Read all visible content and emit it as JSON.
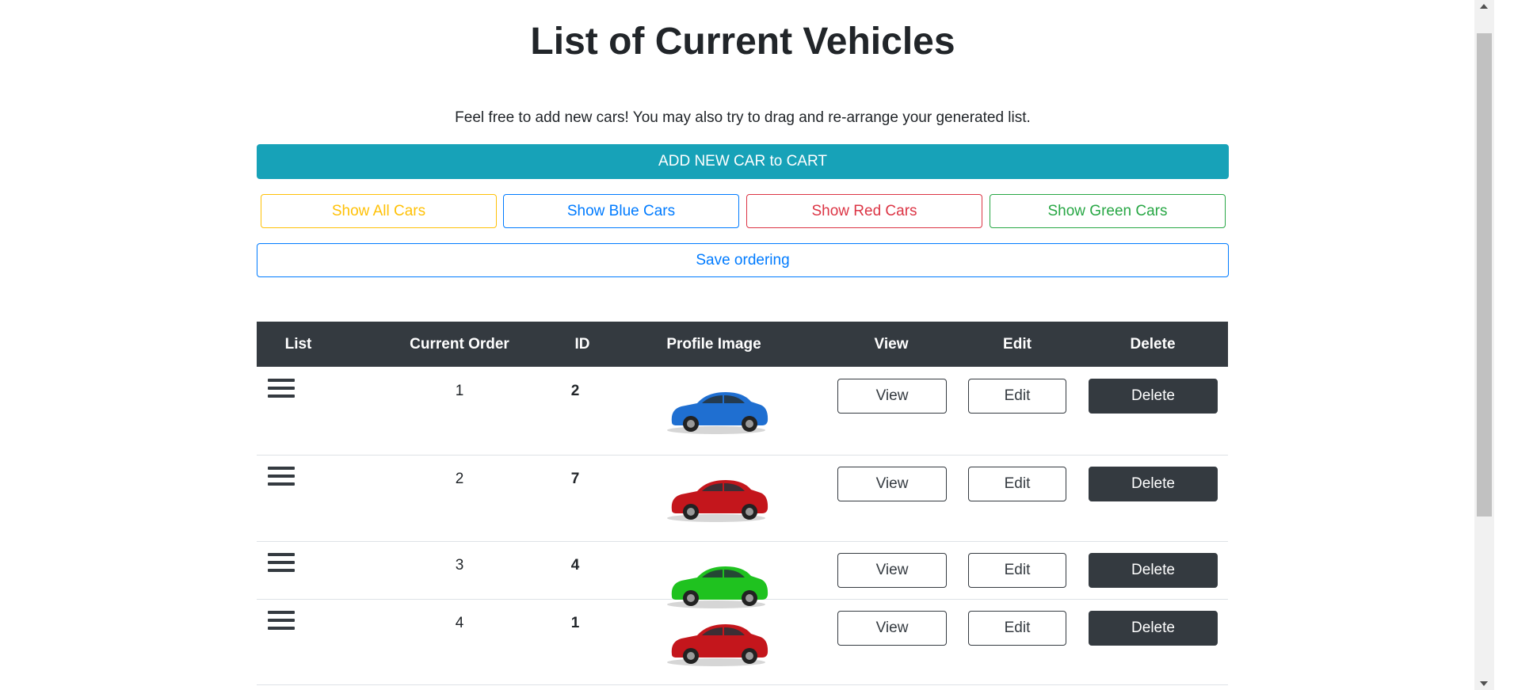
{
  "page": {
    "title": "List of Current Vehicles",
    "subtitle": "Feel free to add new cars! You may also try to drag and re-arrange your generated list."
  },
  "buttons": {
    "add": "ADD NEW CAR to CART",
    "show_all": "Show All Cars",
    "show_blue": "Show Blue Cars",
    "show_red": "Show Red Cars",
    "show_green": "Show Green Cars",
    "save": "Save ordering"
  },
  "table": {
    "headers": [
      "List",
      "Current Order",
      "ID",
      "Profile Image",
      "View",
      "Edit",
      "Delete"
    ],
    "rows": [
      {
        "order": "1",
        "id": "2",
        "color": "blue",
        "view": "View",
        "edit": "Edit",
        "delete": "Delete"
      },
      {
        "order": "2",
        "id": "7",
        "color": "red",
        "view": "View",
        "edit": "Edit",
        "delete": "Delete"
      },
      {
        "order": "3",
        "id": "4",
        "color": "green",
        "view": "View",
        "edit": "Edit",
        "delete": "Delete"
      },
      {
        "order": "4",
        "id": "1",
        "color": "red",
        "view": "View",
        "edit": "Edit",
        "delete": "Delete"
      }
    ]
  },
  "colors": {
    "blue": "#1f6fd1",
    "red": "#c4161c",
    "green": "#1fc21f",
    "accent": "#17a2b8",
    "dark": "#343a40"
  },
  "icons": {
    "drag_handle": "hamburger-icon"
  }
}
